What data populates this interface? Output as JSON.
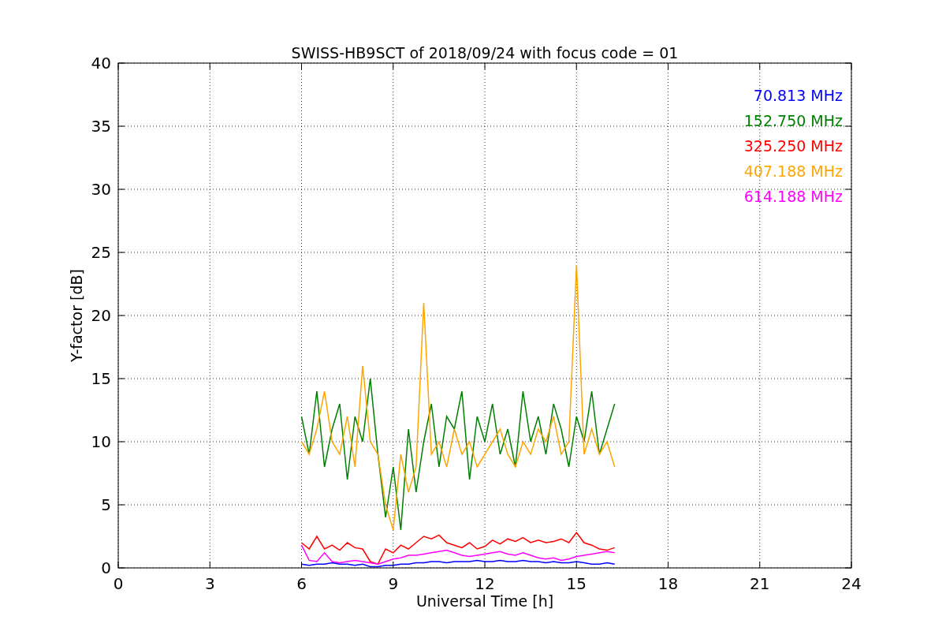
{
  "figure": {
    "chart_data": {
      "type": "line",
      "title": "SWISS-HB9SCT of 2018/09/24 with focus code = 01",
      "xlabel": "Universal Time [h]",
      "ylabel": "Y-factor [dB]",
      "xlim": [
        0,
        24
      ],
      "ylim": [
        0,
        40
      ],
      "xticks": [
        0,
        3,
        6,
        9,
        12,
        15,
        18,
        21,
        24
      ],
      "yticks": [
        0,
        5,
        10,
        15,
        20,
        25,
        30,
        35,
        40
      ],
      "grid": true,
      "x": [
        6,
        6.25,
        6.5,
        6.75,
        7,
        7.25,
        7.5,
        7.75,
        8,
        8.25,
        8.5,
        8.75,
        9,
        9.25,
        9.5,
        9.75,
        10,
        10.25,
        10.5,
        10.75,
        11,
        11.25,
        11.5,
        11.75,
        12,
        12.25,
        12.5,
        12.75,
        13,
        13.25,
        13.5,
        13.75,
        14,
        14.25,
        14.5,
        14.75,
        15,
        15.25,
        15.5,
        15.75,
        16,
        16.25
      ],
      "series": [
        {
          "name": "70.813 MHz",
          "color": "#0000ff",
          "values": [
            0.3,
            0.2,
            0.3,
            0.3,
            0.4,
            0.3,
            0.3,
            0.2,
            0.3,
            0.1,
            0.1,
            0.2,
            0.2,
            0.3,
            0.3,
            0.4,
            0.4,
            0.5,
            0.5,
            0.4,
            0.5,
            0.5,
            0.5,
            0.6,
            0.5,
            0.5,
            0.6,
            0.5,
            0.5,
            0.6,
            0.5,
            0.5,
            0.4,
            0.5,
            0.4,
            0.4,
            0.5,
            0.4,
            0.3,
            0.3,
            0.4,
            0.3
          ]
        },
        {
          "name": "152.750 MHz",
          "color": "#008000",
          "values": [
            12,
            9,
            14,
            8,
            11,
            13,
            7,
            12,
            10,
            15,
            9,
            4,
            8,
            3,
            11,
            6,
            10,
            13,
            8,
            12,
            11,
            14,
            7,
            12,
            10,
            13,
            9,
            11,
            8,
            14,
            10,
            12,
            9,
            13,
            11,
            8,
            12,
            10,
            14,
            9,
            11,
            13
          ]
        },
        {
          "name": "325.250 MHz",
          "color": "#ff0000",
          "values": [
            2,
            1.5,
            2.5,
            1.5,
            1.8,
            1.4,
            2,
            1.6,
            1.5,
            0.5,
            0.3,
            1.5,
            1.2,
            1.8,
            1.5,
            2,
            2.5,
            2.3,
            2.6,
            2,
            1.8,
            1.6,
            2,
            1.5,
            1.7,
            2.2,
            1.9,
            2.3,
            2.1,
            2.4,
            2,
            2.2,
            2,
            2.1,
            2.3,
            2,
            2.8,
            2,
            1.8,
            1.5,
            1.4,
            1.6
          ]
        },
        {
          "name": "407.188 MHz",
          "color": "#ffa500",
          "values": [
            10,
            9,
            11,
            14,
            10,
            9,
            12,
            8,
            16,
            10,
            9,
            5,
            3,
            9,
            6,
            8,
            21,
            9,
            10,
            8,
            11,
            9,
            10,
            8,
            9,
            10,
            11,
            9,
            8,
            10,
            9,
            11,
            10,
            12,
            9,
            10,
            24,
            9,
            11,
            9,
            10,
            8
          ]
        },
        {
          "name": "614.188 MHz",
          "color": "#ff00ff",
          "values": [
            1.8,
            0.6,
            0.5,
            1.2,
            0.5,
            0.4,
            0.5,
            0.6,
            0.5,
            0.4,
            0.3,
            0.5,
            0.7,
            0.8,
            1,
            1,
            1.1,
            1.2,
            1.3,
            1.4,
            1.2,
            1,
            0.9,
            1,
            1.1,
            1.2,
            1.3,
            1.1,
            1,
            1.2,
            1,
            0.8,
            0.7,
            0.8,
            0.6,
            0.7,
            0.9,
            1,
            1.1,
            1.2,
            1.3,
            1.2
          ]
        }
      ]
    }
  }
}
